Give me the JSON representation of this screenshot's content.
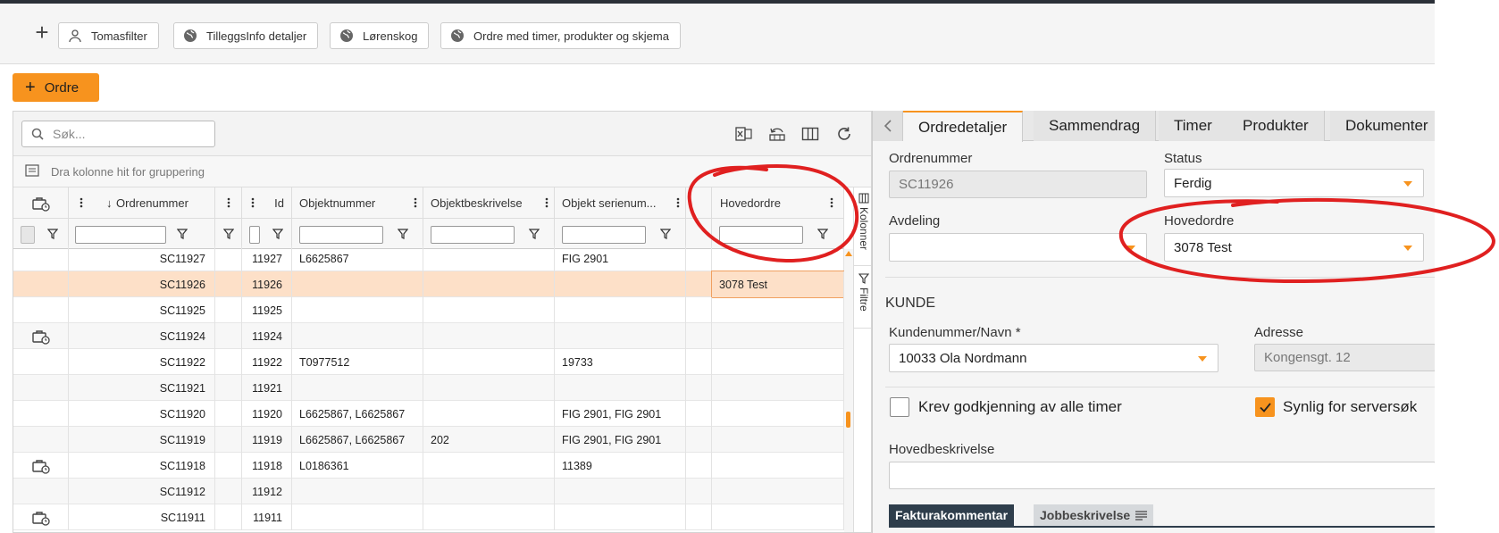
{
  "toolbar": {
    "add_label": "+",
    "chips": [
      {
        "label": "Tomasfilter",
        "icon": "person-icon"
      },
      {
        "label": "TilleggsInfo detaljer",
        "icon": "globe-icon"
      },
      {
        "label": "Lørenskog",
        "icon": "globe-icon"
      },
      {
        "label": "Ordre med timer, produkter og skjema",
        "icon": "globe-icon"
      }
    ],
    "new_order_label": "Ordre"
  },
  "grid": {
    "search_placeholder": "Søk...",
    "group_hint": "Dra kolonne hit for gruppering",
    "columns": [
      "Ordrenummer",
      "Id",
      "Objektnummer",
      "Objektbeskrivelse",
      "Objekt serienum...",
      "Hovedordre"
    ],
    "side_tabs": [
      "Kolonner",
      "Filtre"
    ],
    "rows": [
      {
        "icon": false,
        "ordrenummer": "SC11927",
        "id": "11927",
        "objektnummer": "L6625867",
        "objektbeskrivelse": "",
        "serienummer": "FIG 2901",
        "hovedordre": ""
      },
      {
        "icon": false,
        "ordrenummer": "SC11926",
        "id": "11926",
        "objektnummer": "",
        "objektbeskrivelse": "",
        "serienummer": "",
        "hovedordre": "3078 Test",
        "selected": true
      },
      {
        "icon": false,
        "ordrenummer": "SC11925",
        "id": "11925",
        "objektnummer": "",
        "objektbeskrivelse": "",
        "serienummer": "",
        "hovedordre": ""
      },
      {
        "icon": true,
        "ordrenummer": "SC11924",
        "id": "11924",
        "objektnummer": "",
        "objektbeskrivelse": "",
        "serienummer": "",
        "hovedordre": ""
      },
      {
        "icon": false,
        "ordrenummer": "SC11922",
        "id": "11922",
        "objektnummer": "T0977512",
        "objektbeskrivelse": "",
        "serienummer": "19733",
        "hovedordre": ""
      },
      {
        "icon": false,
        "ordrenummer": "SC11921",
        "id": "11921",
        "objektnummer": "",
        "objektbeskrivelse": "",
        "serienummer": "",
        "hovedordre": ""
      },
      {
        "icon": false,
        "ordrenummer": "SC11920",
        "id": "11920",
        "objektnummer": "L6625867, L6625867",
        "objektbeskrivelse": "",
        "serienummer": "FIG 2901, FIG 2901",
        "hovedordre": ""
      },
      {
        "icon": false,
        "ordrenummer": "SC11919",
        "id": "11919",
        "objektnummer": "L6625867, L6625867",
        "objektbeskrivelse": "202",
        "serienummer": "FIG 2901, FIG 2901",
        "hovedordre": ""
      },
      {
        "icon": true,
        "ordrenummer": "SC11918",
        "id": "11918",
        "objektnummer": "L0186361",
        "objektbeskrivelse": "",
        "serienummer": "11389",
        "hovedordre": ""
      },
      {
        "icon": false,
        "ordrenummer": "SC11912",
        "id": "11912",
        "objektnummer": "",
        "objektbeskrivelse": "",
        "serienummer": "",
        "hovedordre": ""
      },
      {
        "icon": true,
        "ordrenummer": "SC11911",
        "id": "11911",
        "objektnummer": "",
        "objektbeskrivelse": "",
        "serienummer": "",
        "hovedordre": ""
      }
    ]
  },
  "detail": {
    "tabs": [
      "Ordredetaljer",
      "Sammendrag",
      "Timer",
      "Produkter",
      "Dokumenter"
    ],
    "ordrenummer_label": "Ordrenummer",
    "ordrenummer_value": "SC11926",
    "status_label": "Status",
    "status_value": "Ferdig",
    "avdeling_label": "Avdeling",
    "avdeling_value": "",
    "hovedordre_label": "Hovedordre",
    "hovedordre_value": "3078 Test",
    "kunde_section": "KUNDE",
    "kunde_label": "Kundenummer/Navn *",
    "kunde_value": "10033 Ola Nordmann",
    "adresse_label": "Adresse",
    "adresse_value": "Kongensgt. 12",
    "krev_label": "Krev godkjenning av alle timer",
    "krev_checked": false,
    "synlig_label": "Synlig for serversøk",
    "synlig_checked": true,
    "hovedbeskrivelse_label": "Hovedbeskrivelse",
    "hovedbeskrivelse_value": "",
    "editor_tabs": [
      "Fakturakommentar",
      "Jobbeskrivelse"
    ]
  },
  "colors": {
    "accent": "#f7931e",
    "selected_row": "#fde0c8",
    "annotation": "#e02020"
  }
}
